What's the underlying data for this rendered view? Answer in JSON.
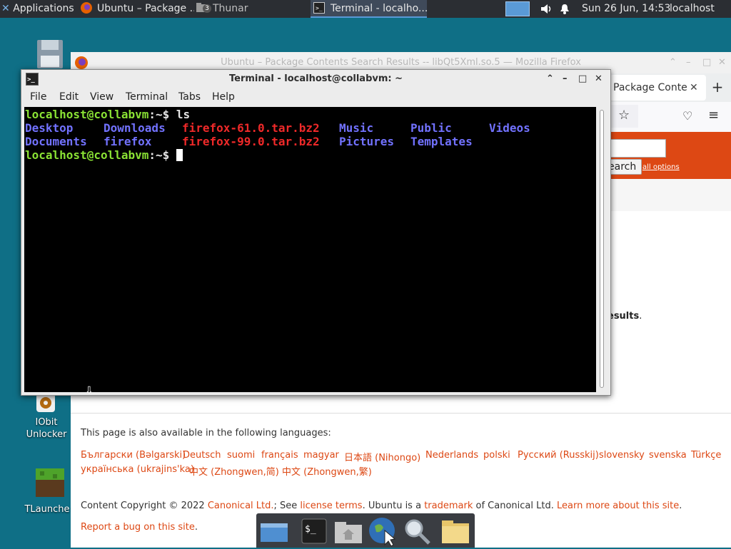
{
  "panel": {
    "applications": "Applications",
    "task_firefox": "Ubuntu – Package ...",
    "task_thunar": "Thunar",
    "thunar_badge": "3",
    "task_terminal": "Terminal - localho...",
    "clock": "Sun 26 Jun, 14:53",
    "hostname": "localhost"
  },
  "desktop": {
    "iobit_label": "IObit\nUnlocker",
    "tlauncher_label": "TLaunche"
  },
  "firefox": {
    "window_title": "Ubuntu – Package Contents Search Results -- libQt5Xml.so.5 — Mozilla Firefox",
    "tab_label": "Package Conte",
    "search_button": "earch",
    "all_options": "all options",
    "results_fragment": "esults",
    "results_period": ".",
    "languages_heading": "This page is also available in the following languages:",
    "languages_row1": [
      "Български (Bəlgarski)",
      "Deutsch",
      "suomi",
      "français",
      "magyar",
      "日本語 (Nihongo)",
      "Nederlands",
      "polski",
      "Русский (Russkij)",
      "slovensky",
      "svenska",
      "Türkçe"
    ],
    "languages_row2": [
      "українська (ukrajins'ka)",
      "中文 (Zhongwen,简)",
      "中文 (Zhongwen,繁)"
    ],
    "footer": {
      "copyright_prefix": "Content Copyright © 2022 ",
      "canonical": "Canonical Ltd.",
      "see": "; See ",
      "license": "license terms",
      "ubuntu_is": ". Ubuntu is a ",
      "trademark": "trademark",
      "of_canonical": " of Canonical Ltd. ",
      "learn_more": "Learn more about this site",
      "period": ".",
      "report_bug": "Report a bug on this site",
      "report_period": "."
    }
  },
  "terminal": {
    "title": "Terminal - localhost@collabvm: ~",
    "menu": [
      "File",
      "Edit",
      "View",
      "Terminal",
      "Tabs",
      "Help"
    ],
    "prompt_user": "localhost@collabvm",
    "prompt_path": ":~",
    "prompt_symbol": "$ ",
    "command": "ls",
    "listing_row1": [
      {
        "name": "Desktop",
        "kind": "dir"
      },
      {
        "name": "Downloads",
        "kind": "dir"
      },
      {
        "name": "firefox-61.0.tar.bz2",
        "kind": "archive"
      },
      {
        "name": "Music",
        "kind": "dir"
      },
      {
        "name": "Public",
        "kind": "dir"
      },
      {
        "name": "Videos",
        "kind": "dir"
      }
    ],
    "listing_row2": [
      {
        "name": "Documents",
        "kind": "dir"
      },
      {
        "name": "firefox",
        "kind": "dir"
      },
      {
        "name": "firefox-99.0.tar.bz2",
        "kind": "archive"
      },
      {
        "name": "Pictures",
        "kind": "dir"
      },
      {
        "name": "Templates",
        "kind": "dir"
      }
    ]
  },
  "dock": {
    "icons": [
      "show-desktop-icon",
      "terminal-icon",
      "home-folder-icon",
      "web-browser-icon",
      "search-icon",
      "files-icon"
    ]
  },
  "colors": {
    "ubuntu_orange": "#dd4814",
    "term_green": "#8ae234",
    "term_blue": "#7272ff",
    "term_red": "#ef2929"
  }
}
